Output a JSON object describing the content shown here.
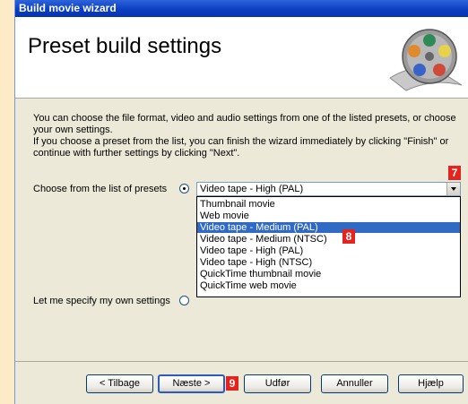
{
  "window": {
    "title": "Build movie wizard",
    "heading": "Preset build settings",
    "icon": "film-reel-icon"
  },
  "intro": {
    "line1": "You can choose the file format, video and audio settings from one of the listed presets, or choose your own settings.",
    "line2": "If you choose a preset from the list, you can finish the wizard immediately by clicking \"Finish\" or continue with further settings by clicking \"Next\"."
  },
  "preset_option": {
    "label": "Choose from the list of presets",
    "selected": true,
    "value": "Video tape - High (PAL)",
    "items": [
      "Thumbnail movie",
      "Web movie",
      "Video tape - Medium (PAL)",
      "Video tape - Medium (NTSC)",
      "Video tape - High (PAL)",
      "Video tape - High (NTSC)",
      "QuickTime thumbnail movie",
      "QuickTime web movie"
    ],
    "highlighted": "Video tape - Medium (PAL)"
  },
  "custom_option": {
    "label": "Let me specify my own settings",
    "selected": false
  },
  "buttons": {
    "back": "< Tilbage",
    "next": "Næste >",
    "finish": "Udfør",
    "cancel": "Annuller",
    "help": "Hjælp"
  },
  "callouts": {
    "dropdown_arrow": "7",
    "list_item": "8",
    "next_button": "9"
  },
  "colors": {
    "callout": "#E52420",
    "titlebar": "#0A3CC0",
    "selection": "#316AC5",
    "page_bg": "#FCEBC6"
  }
}
